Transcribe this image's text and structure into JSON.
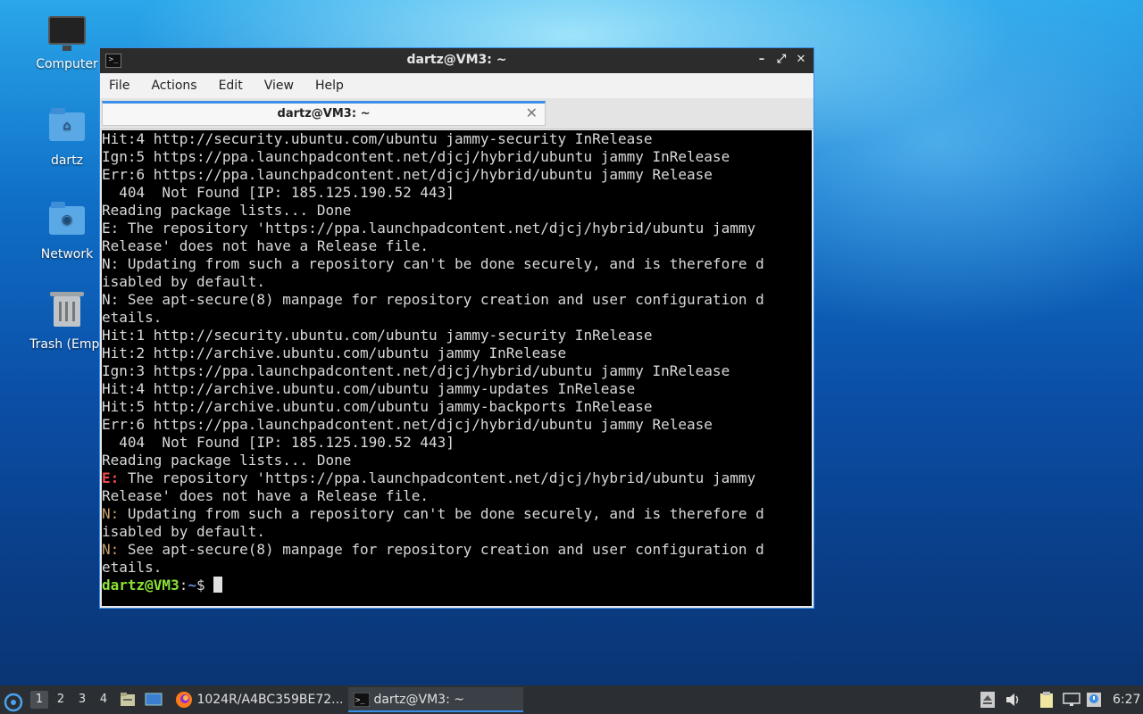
{
  "desktop": {
    "icons": [
      {
        "label": "Computer"
      },
      {
        "label": "dartz"
      },
      {
        "label": "Network"
      },
      {
        "label": "Trash (Empt"
      }
    ]
  },
  "window": {
    "title": "dartz@VM3: ~",
    "menu": [
      "File",
      "Actions",
      "Edit",
      "View",
      "Help"
    ],
    "tab_label": "dartz@VM3: ~",
    "tab_close": "✕",
    "accent_color": "#3a8ee6"
  },
  "terminal": {
    "lines": [
      "Hit:4 http://security.ubuntu.com/ubuntu jammy-security InRelease",
      "Ign:5 https://ppa.launchpadcontent.net/djcj/hybrid/ubuntu jammy InRelease",
      "Err:6 https://ppa.launchpadcontent.net/djcj/hybrid/ubuntu jammy Release",
      "  404  Not Found [IP: 185.125.190.52 443]",
      "Reading package lists... Done",
      "E: The repository 'https://ppa.launchpadcontent.net/djcj/hybrid/ubuntu jammy",
      "Release' does not have a Release file.",
      "N: Updating from such a repository can't be done securely, and is therefore d",
      "isabled by default.",
      "N: See apt-secure(8) manpage for repository creation and user configuration d",
      "etails.",
      "Hit:1 http://security.ubuntu.com/ubuntu jammy-security InRelease",
      "Hit:2 http://archive.ubuntu.com/ubuntu jammy InRelease",
      "Ign:3 https://ppa.launchpadcontent.net/djcj/hybrid/ubuntu jammy InRelease",
      "Hit:4 http://archive.ubuntu.com/ubuntu jammy-updates InRelease",
      "Hit:5 http://archive.ubuntu.com/ubuntu jammy-backports InRelease",
      "Err:6 https://ppa.launchpadcontent.net/djcj/hybrid/ubuntu jammy Release",
      "  404  Not Found [IP: 185.125.190.52 443]",
      "Reading package lists... Done"
    ],
    "colored_lines": [
      {
        "prefix": "E:",
        "prefix_color": "red",
        "text": " The repository 'https://ppa.launchpadcontent.net/djcj/hybrid/ubuntu jammy"
      },
      {
        "prefix": "",
        "prefix_color": "",
        "text": "Release' does not have a Release file."
      },
      {
        "prefix": "N:",
        "prefix_color": "orange",
        "text": " Updating from such a repository can't be done securely, and is therefore d"
      },
      {
        "prefix": "",
        "prefix_color": "",
        "text": "isabled by default."
      },
      {
        "prefix": "N:",
        "prefix_color": "orange",
        "text": " See apt-secure(8) manpage for repository creation and user configuration d"
      },
      {
        "prefix": "",
        "prefix_color": "",
        "text": "etails."
      }
    ],
    "prompt_user": "dartz@VM3",
    "prompt_sep": ":",
    "prompt_path": "~",
    "prompt_symbol": "$ "
  },
  "taskbar": {
    "workspaces": [
      "1",
      "2",
      "3",
      "4"
    ],
    "active_workspace": "1",
    "tasks": [
      {
        "label": "1024R/A4BC359BE72...",
        "icon": "firefox-icon"
      },
      {
        "label": "dartz@VM3: ~",
        "icon": "terminal-icon"
      }
    ],
    "clock": "6:27"
  }
}
